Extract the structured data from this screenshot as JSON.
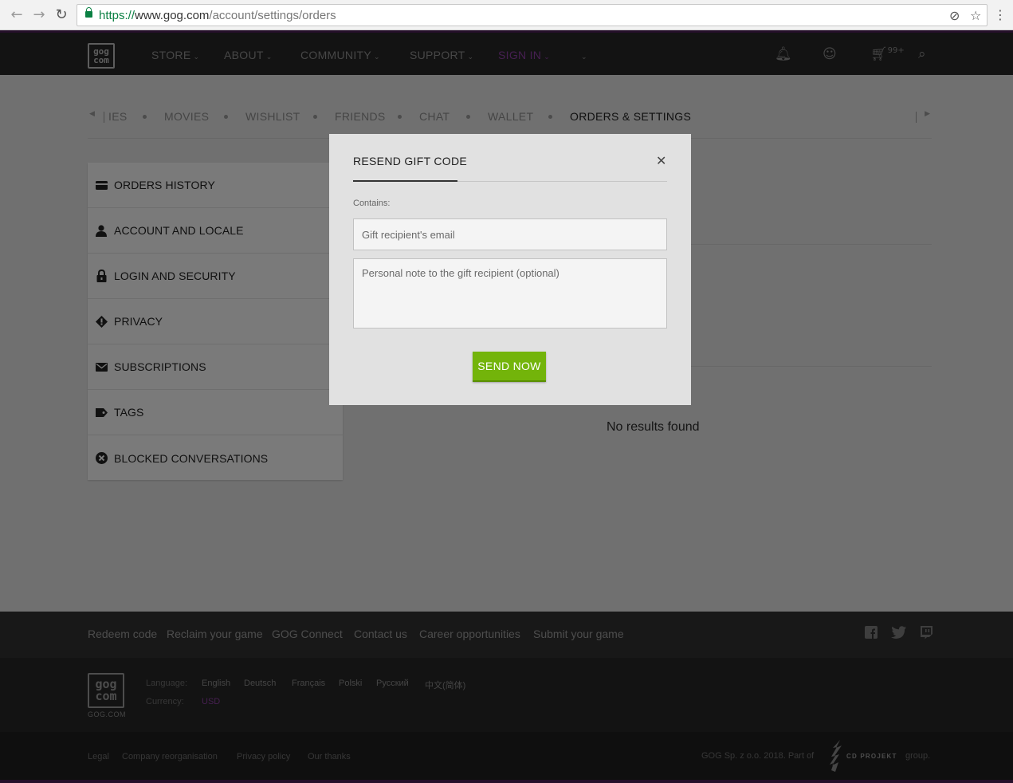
{
  "browser": {
    "url_scheme": "https://",
    "url_host": "www.gog.com",
    "url_path": "/account/settings/orders"
  },
  "header": {
    "logo_line1": "gog",
    "logo_line2": "com",
    "nav": [
      {
        "label": "STORE"
      },
      {
        "label": "ABOUT"
      },
      {
        "label": "COMMUNITY"
      },
      {
        "label": "SUPPORT"
      },
      {
        "label": "SIGN IN"
      }
    ],
    "cart_count": "99+",
    "accent_color": "#8c3fa3"
  },
  "subnav": {
    "items": [
      "ΙES",
      "MOVIES",
      "WISHLIST",
      "FRIENDS",
      "CHAT",
      "WALLET",
      "ORDERS & SETTINGS"
    ],
    "active": "ORDERS & SETTINGS"
  },
  "sidebar": {
    "items": [
      {
        "label": "ORDERS HISTORY",
        "icon": "card-icon"
      },
      {
        "label": "ACCOUNT AND LOCALE",
        "icon": "user-icon"
      },
      {
        "label": "LOGIN AND SECURITY",
        "icon": "lock-icon"
      },
      {
        "label": "PRIVACY",
        "icon": "shield-icon"
      },
      {
        "label": "SUBSCRIPTIONS",
        "icon": "envelope-icon"
      },
      {
        "label": "TAGS",
        "icon": "tag-icon"
      },
      {
        "label": "BLOCKED CONVERSATIONS",
        "icon": "blocked-icon"
      }
    ]
  },
  "main": {
    "no_results": "No results found"
  },
  "modal": {
    "title": "RESEND GIFT CODE",
    "contains_label": "Contains:",
    "email_placeholder": "Gift recipient's email",
    "note_placeholder": "Personal note to the gift recipient (optional)",
    "send_label": "SEND NOW",
    "button_color": "#73b40a"
  },
  "footer": {
    "links": [
      "Redeem code",
      "Reclaim your game",
      "GOG Connect",
      "Contact us",
      "Career opportunities",
      "Submit your game"
    ],
    "logo_text": "GOG.COM",
    "language_label": "Language:",
    "languages": [
      "English",
      "Deutsch",
      "Français",
      "Polski",
      "Русский",
      "中文(简体)"
    ],
    "currency_label": "Currency:",
    "currency": "USD",
    "legal_links": [
      "Legal",
      "Company reorganisation",
      "Privacy policy",
      "Our thanks"
    ],
    "copyright": "GOG Sp. z o.o. 2018. Part of",
    "cdp": "CD PROJEKT",
    "group": "group."
  }
}
